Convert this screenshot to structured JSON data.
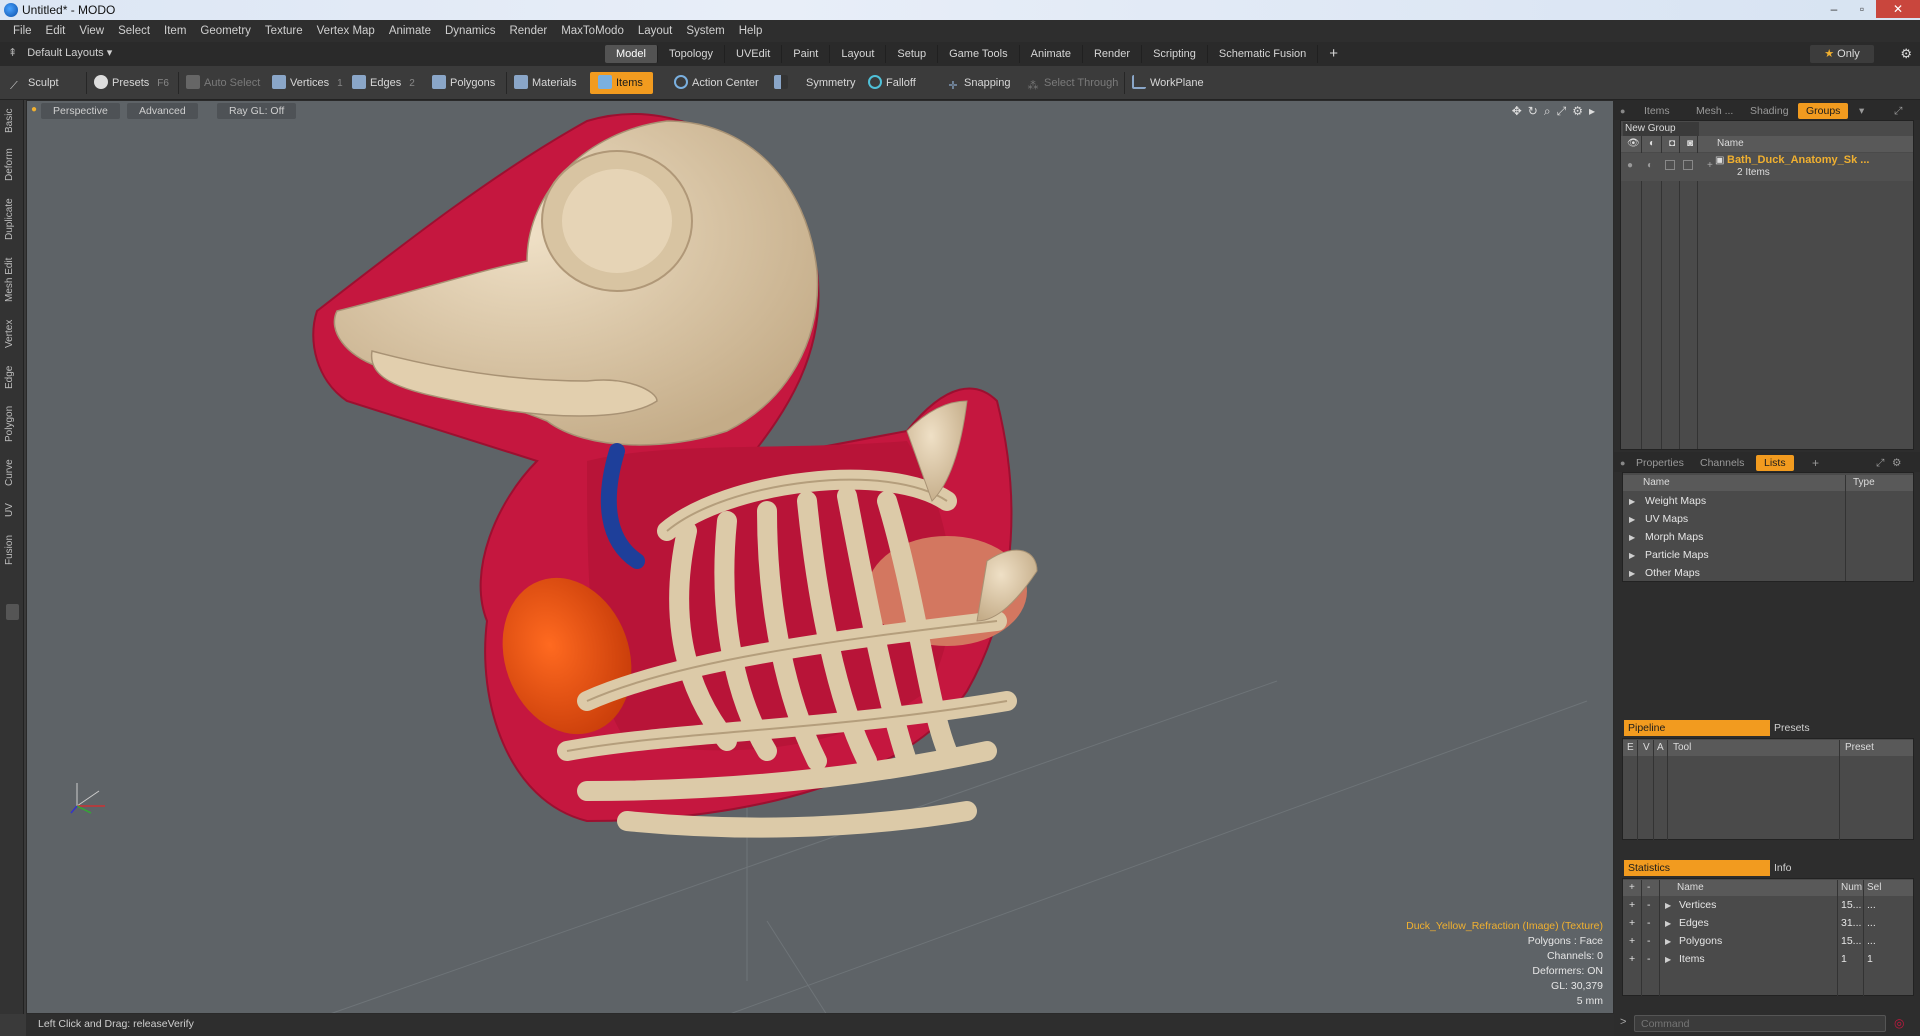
{
  "window": {
    "title": "Untitled* - MODO",
    "minimize": "–",
    "maximize": "▫",
    "close": "✕"
  },
  "menu": [
    "File",
    "Edit",
    "View",
    "Select",
    "Item",
    "Geometry",
    "Texture",
    "Vertex Map",
    "Animate",
    "Dynamics",
    "Render",
    "MaxToModo",
    "Layout",
    "System",
    "Help"
  ],
  "layouts": {
    "dropdown": "Default Layouts ▾",
    "tabs": [
      "Model",
      "Topology",
      "UVEdit",
      "Paint",
      "Layout",
      "Setup",
      "Game Tools",
      "Animate",
      "Render",
      "Scripting",
      "Schematic Fusion"
    ],
    "active_tab": "Model",
    "add": "+",
    "only_label": "Only"
  },
  "toolbar": {
    "sculpt": "Sculpt",
    "presets": "Presets",
    "presets_key": "F6",
    "auto_select": "Auto Select",
    "vertices": "Vertices",
    "vertices_key": "1",
    "edges": "Edges",
    "edges_key": "2",
    "polygons": "Polygons",
    "materials": "Materials",
    "items": "Items",
    "action_center": "Action Center",
    "symmetry": "Symmetry",
    "falloff": "Falloff",
    "snapping": "Snapping",
    "select_through": "Select Through",
    "workplane": "WorkPlane"
  },
  "left_tabs": [
    "Basic",
    "Deform",
    "Duplicate",
    "Mesh Edit",
    "Vertex",
    "Edge",
    "Polygon",
    "Curve",
    "UV",
    "Fusion"
  ],
  "viewport": {
    "view": "Perspective",
    "shading": "Advanced",
    "raygl": "Ray GL: Off",
    "info": {
      "texture": "Duck_Yellow_Refraction (Image) (Texture)",
      "polygons": "Polygons : Face",
      "channels": "Channels: 0",
      "deformers": "Deformers: ON",
      "gl": "GL: 30,379",
      "scale": "5 mm"
    }
  },
  "status": "Left Click and Drag:   releaseVerify",
  "groups_panel": {
    "tabs": [
      "Items",
      "Mesh ...",
      "Shading",
      "Groups"
    ],
    "active_tab": "Groups",
    "new_group": "New Group",
    "col_name": "Name",
    "group_name": "Bath_Duck_Anatomy_Sk ...",
    "group_count": "2 Items"
  },
  "lists_panel": {
    "tabs": [
      "Properties",
      "Channels",
      "Lists"
    ],
    "active_tab": "Lists",
    "add": "+",
    "col_name": "Name",
    "col_type": "Type",
    "rows": [
      "Weight Maps",
      "UV Maps",
      "Morph Maps",
      "Particle Maps",
      "Other Maps"
    ]
  },
  "pipeline_panel": {
    "tab_active": "Pipeline",
    "tab_other": "Presets",
    "cols": [
      "E",
      "V",
      "A",
      "Tool",
      "Preset"
    ]
  },
  "stats_panel": {
    "tab_active": "Statistics",
    "tab_other": "Info",
    "col_plus": "+",
    "col_minus": "-",
    "col_name": "Name",
    "col_num": "Num",
    "col_sel": "Sel",
    "rows": [
      {
        "name": "Vertices",
        "num": "15...",
        "sel": "..."
      },
      {
        "name": "Edges",
        "num": "31...",
        "sel": "..."
      },
      {
        "name": "Polygons",
        "num": "15...",
        "sel": "..."
      },
      {
        "name": "Items",
        "num": "1",
        "sel": "1"
      }
    ]
  },
  "command": {
    "prompt": ">",
    "placeholder": "Command"
  },
  "colors": {
    "accent": "#f29b1f",
    "viewport_bg": "#5e6367",
    "bone": "#ddc8a8",
    "flesh": "#c5173f"
  }
}
